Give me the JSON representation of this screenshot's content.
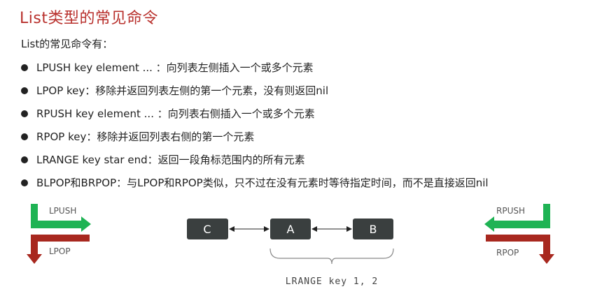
{
  "title": "List类型的常见命令",
  "subtitle": "List的常见命令有：",
  "commands": [
    "LPUSH key  element ... ：向列表左侧插入一个或多个元素",
    "LPOP key：移除并返回列表左侧的第一个元素，没有则返回nil",
    "RPUSH key  element ... ：向列表右侧插入一个或多个元素",
    "RPOP key：移除并返回列表右侧的第一个元素",
    "LRANGE key star end：返回一段角标范围内的所有元素",
    "BLPOP和BRPOP：与LPOP和RPOP类似，只不过在没有元素时等待指定时间，而不是直接返回nil"
  ],
  "diagram": {
    "nodes": [
      "C",
      "A",
      "B"
    ],
    "left_push": "LPUSH",
    "left_pop": "LPOP",
    "right_push": "RPUSH",
    "right_pop": "RPOP",
    "range_label": "LRANGE key 1, 2",
    "colors": {
      "push": "#1fb354",
      "pop": "#a8281f",
      "node": "#3a3f3f"
    }
  }
}
